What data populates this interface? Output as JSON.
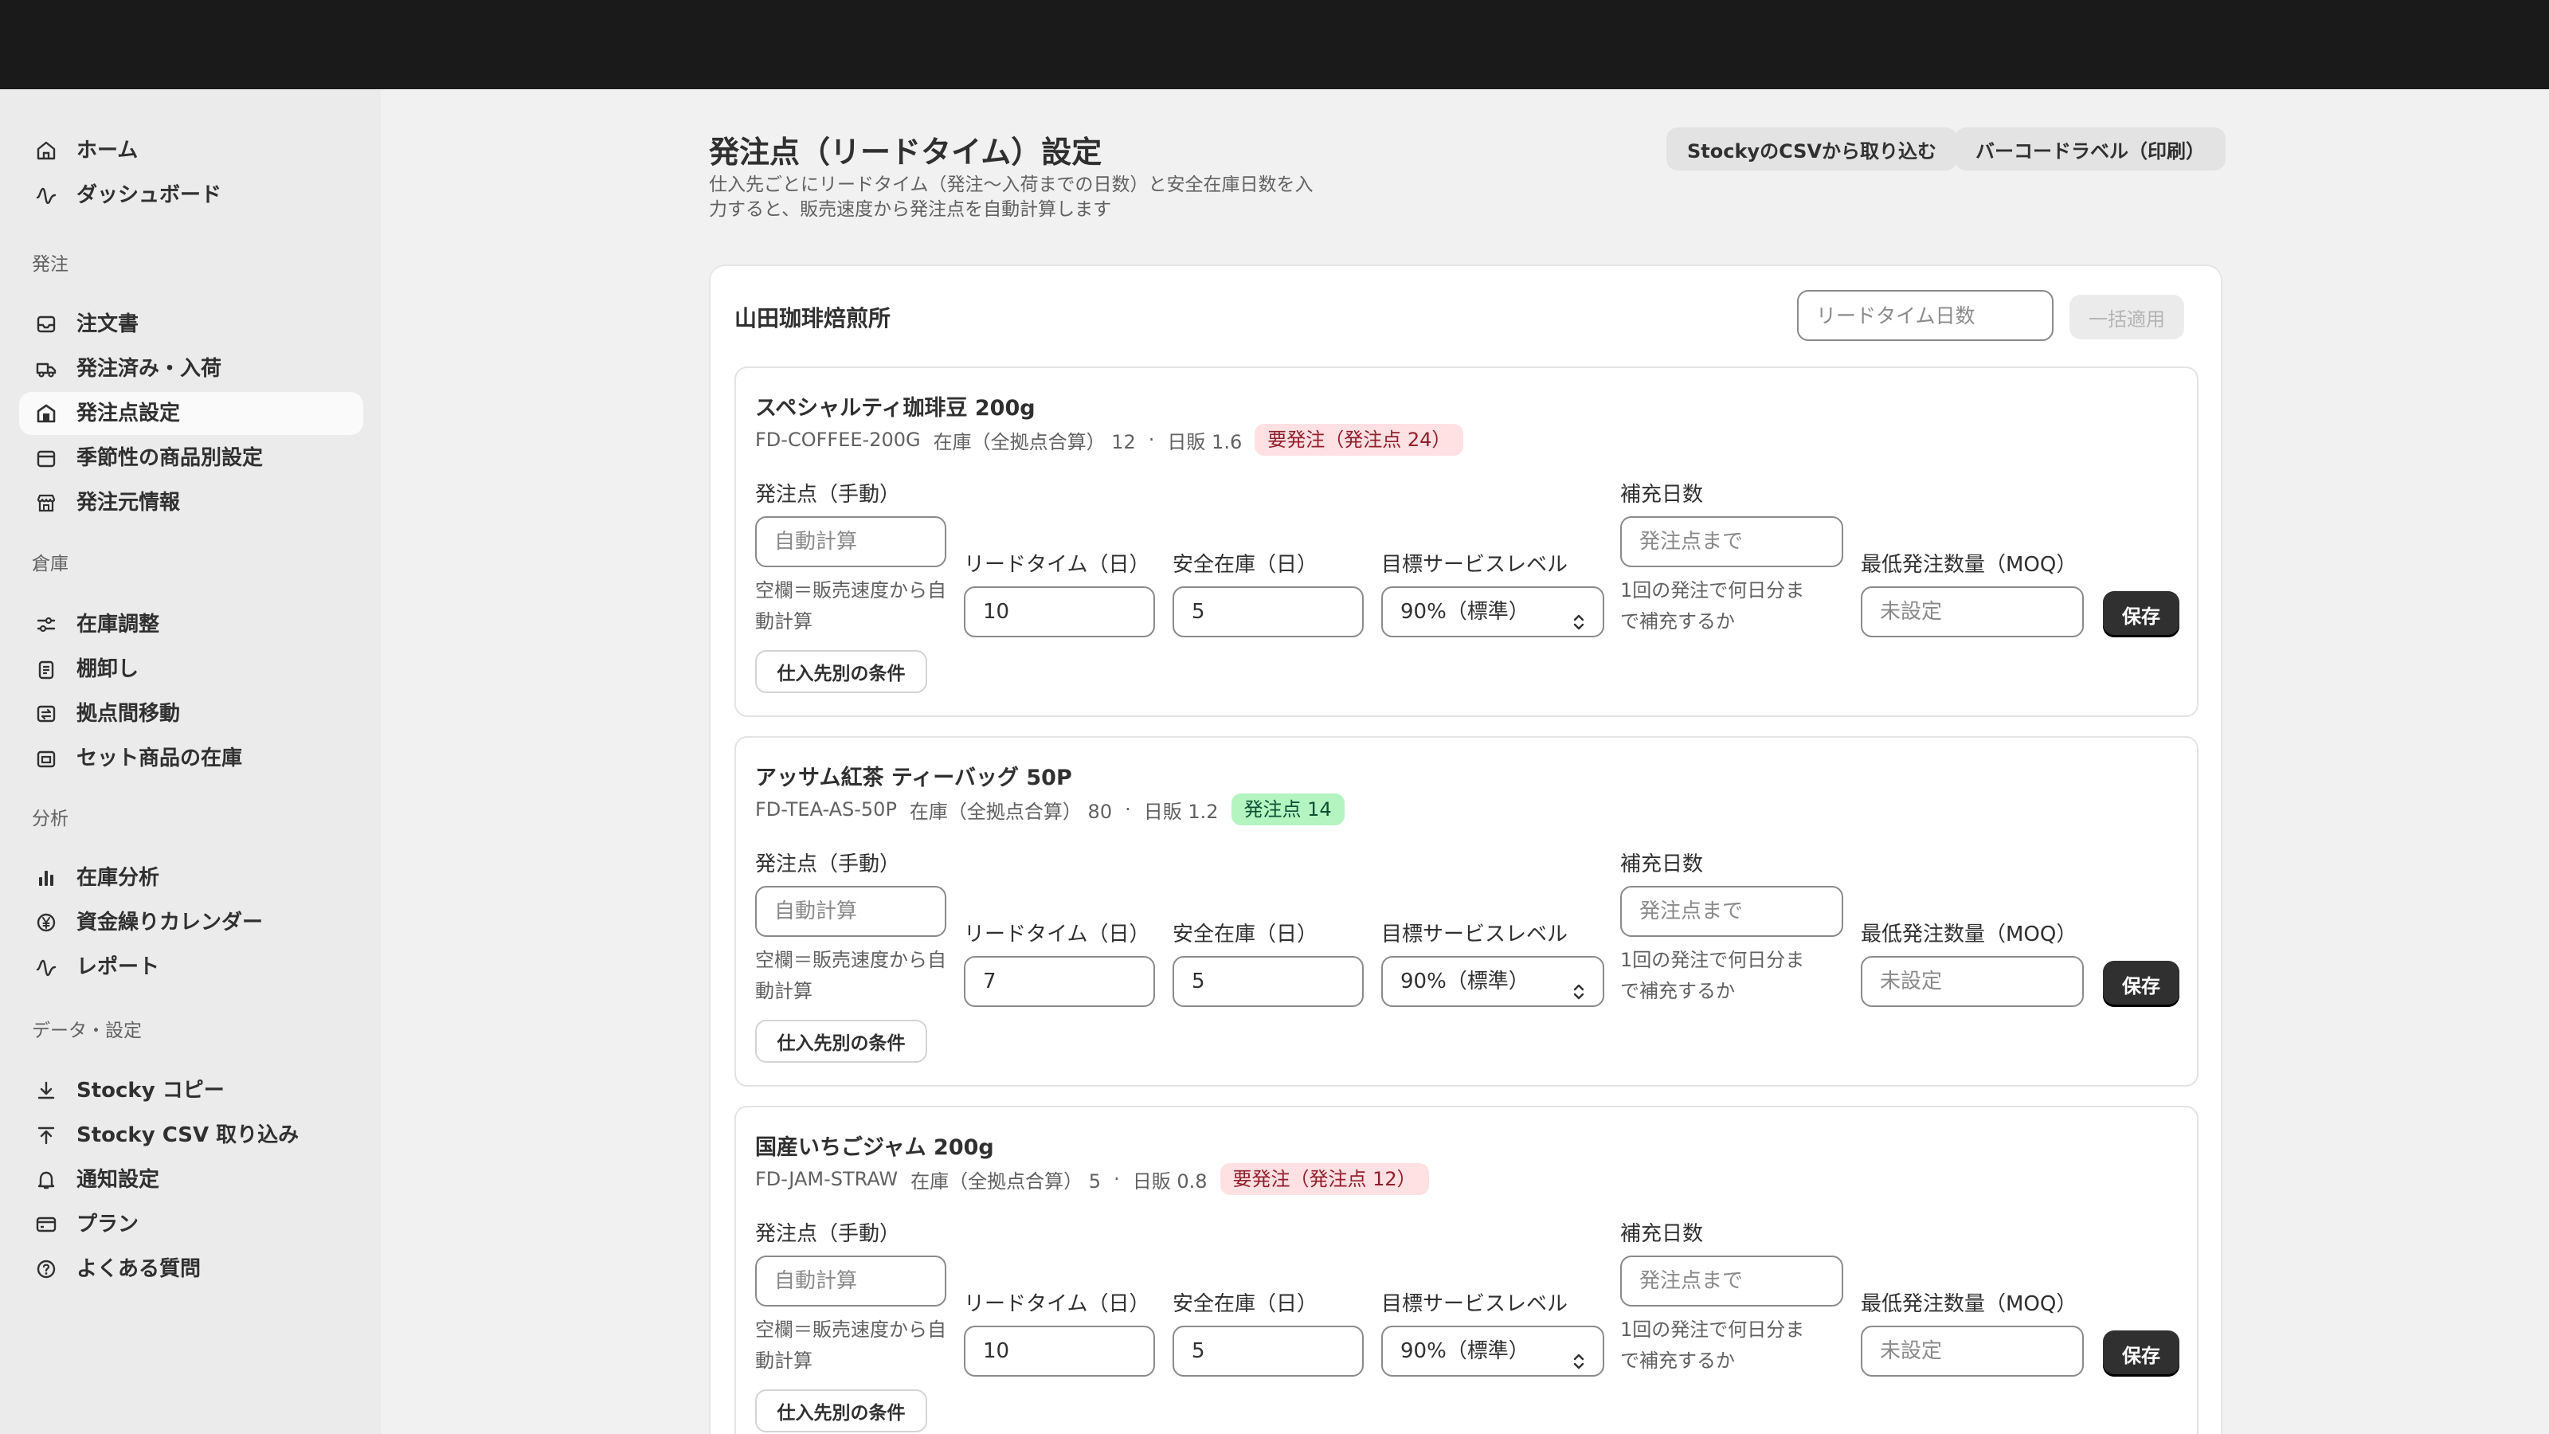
{
  "sidebar": {
    "top_items": [
      {
        "label": "ホーム",
        "icon": "home-icon"
      },
      {
        "label": "ダッシュボード",
        "icon": "pulse-icon"
      }
    ],
    "sections": [
      {
        "title": "発注",
        "items": [
          {
            "label": "注文書",
            "icon": "inbox-icon"
          },
          {
            "label": "発注済み・入荷",
            "icon": "truck-icon"
          },
          {
            "label": "発注点設定",
            "icon": "store-icon",
            "active": true
          },
          {
            "label": "季節性の商品別設定",
            "icon": "calendar-icon"
          },
          {
            "label": "発注元情報",
            "icon": "shop-icon"
          }
        ]
      },
      {
        "title": "倉庫",
        "items": [
          {
            "label": "在庫調整",
            "icon": "sliders-icon"
          },
          {
            "label": "棚卸し",
            "icon": "clipboard-icon"
          },
          {
            "label": "拠点間移動",
            "icon": "transfer-icon"
          },
          {
            "label": "セット商品の在庫",
            "icon": "bundle-icon"
          }
        ]
      },
      {
        "title": "分析",
        "items": [
          {
            "label": "在庫分析",
            "icon": "bar-chart-icon"
          },
          {
            "label": "資金繰りカレンダー",
            "icon": "yen-icon"
          },
          {
            "label": "レポート",
            "icon": "pulse-icon"
          }
        ]
      },
      {
        "title": "データ・設定",
        "items": [
          {
            "label": "Stocky コピー",
            "icon": "download-icon"
          },
          {
            "label": "Stocky CSV 取り込み",
            "icon": "upload-icon"
          },
          {
            "label": "通知設定",
            "icon": "bell-icon"
          },
          {
            "label": "プラン",
            "icon": "credit-card-icon"
          },
          {
            "label": "よくある質問",
            "icon": "question-icon"
          }
        ]
      }
    ]
  },
  "header": {
    "title": "発注点（リードタイム）設定",
    "description": "仕入先ごとにリードタイム（発注〜入荷までの日数）と安全在庫日数を入力すると、販売速度から発注点を自動計算します",
    "import_button": "StockyのCSVから取り込む",
    "label_button": "バーコードラベル（印刷）"
  },
  "supplier": {
    "name": "山田珈琲焙煎所",
    "bulk_placeholder": "リードタイム日数",
    "bulk_apply": "一括適用"
  },
  "labels": {
    "reorder_point": "発注点（手動）",
    "reorder_placeholder": "自動計算",
    "reorder_help": "空欄＝販売速度から自動計算",
    "lead_time": "リードタイム（日）",
    "safety_stock": "安全在庫（日）",
    "service_level": "目標サービスレベル",
    "replenish_days": "補充日数",
    "replenish_placeholder": "発注点まで",
    "replenish_help": "1回の発注で何日分まで補充するか",
    "moq": "最低発注数量（MOQ）",
    "moq_placeholder": "未設定",
    "conditions_button": "仕入先別の条件",
    "save_button": "保存"
  },
  "products": [
    {
      "name": "スペシャルティ珈琲豆 200g",
      "sku": "FD-COFFEE-200G",
      "stock_text": "在庫（全拠点合算） 12",
      "sales_text": "日販 1.6",
      "badge": "要発注（発注点 24）",
      "badge_type": "warn",
      "lead_time": "10",
      "safety_stock": "5",
      "service_level": "90%（標準）"
    },
    {
      "name": "アッサム紅茶 ティーバッグ 50P",
      "sku": "FD-TEA-AS-50P",
      "stock_text": "在庫（全拠点合算） 80",
      "sales_text": "日販 1.2",
      "badge": "発注点 14",
      "badge_type": "ok",
      "lead_time": "7",
      "safety_stock": "5",
      "service_level": "90%（標準）"
    },
    {
      "name": "国産いちごジャム 200g",
      "sku": "FD-JAM-STRAW",
      "stock_text": "在庫（全拠点合算） 5",
      "sales_text": "日販 0.8",
      "badge": "要発注（発注点 12）",
      "badge_type": "warn",
      "lead_time": "10",
      "safety_stock": "5",
      "service_level": "90%（標準）"
    }
  ]
}
